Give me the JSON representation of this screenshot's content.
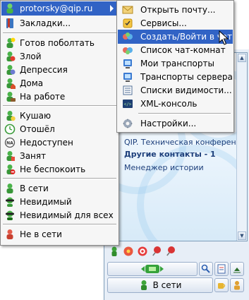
{
  "main_menu": {
    "account": "protorsky@qip.ru",
    "bookmarks": "Закладки...",
    "statuses_a": [
      {
        "label": "Готов поболтать",
        "icon": "ready-to-chat-icon"
      },
      {
        "label": "Злой",
        "icon": "angry-icon"
      },
      {
        "label": "Депрессия",
        "icon": "depression-icon"
      },
      {
        "label": "Дома",
        "icon": "at-home-icon"
      },
      {
        "label": "На работе",
        "icon": "at-work-icon"
      }
    ],
    "statuses_b": [
      {
        "label": "Кушаю",
        "icon": "eating-icon"
      },
      {
        "label": "Отошёл",
        "icon": "away-icon"
      },
      {
        "label": "Недоступен",
        "icon": "not-available-icon"
      },
      {
        "label": "Занят",
        "icon": "busy-icon"
      },
      {
        "label": "Не беспокоить",
        "icon": "do-not-disturb-icon"
      }
    ],
    "statuses_c": [
      {
        "label": "В сети",
        "icon": "online-icon"
      },
      {
        "label": "Невидимый",
        "icon": "invisible-icon"
      },
      {
        "label": "Невидимый для всех",
        "icon": "invisible-for-all-icon"
      }
    ],
    "offline": "Не в сети"
  },
  "sub_menu": {
    "items_a": [
      {
        "label": "Открыть почту...",
        "icon": "mail-icon"
      },
      {
        "label": "Сервисы...",
        "icon": "services-icon"
      },
      {
        "label": "Создать/Войти в чат",
        "icon": "chat-icon"
      },
      {
        "label": "Список чат-комнат",
        "icon": "chat-rooms-icon"
      },
      {
        "label": "Мои транспорты",
        "icon": "transports-icon"
      },
      {
        "label": "Транспорты сервера",
        "icon": "server-transports-icon"
      },
      {
        "label": "Списки видимости...",
        "icon": "visibility-lists-icon"
      },
      {
        "label": "XML-консоль",
        "icon": "xml-console-icon"
      }
    ],
    "settings": {
      "label": "Настройки...",
      "icon": "settings-icon"
    }
  },
  "contacts": {
    "conference": "QIP. Техническая конференция.",
    "other_group": "Другие контакты - 1",
    "history_manager": "Менеджер истории"
  },
  "status_button": "В сети",
  "colors": {
    "menu_highlight": "#3163c5",
    "menu_bg": "#f6f6f6",
    "window_bg": "#e7eef7",
    "contact_text": "#1c3e7a"
  }
}
